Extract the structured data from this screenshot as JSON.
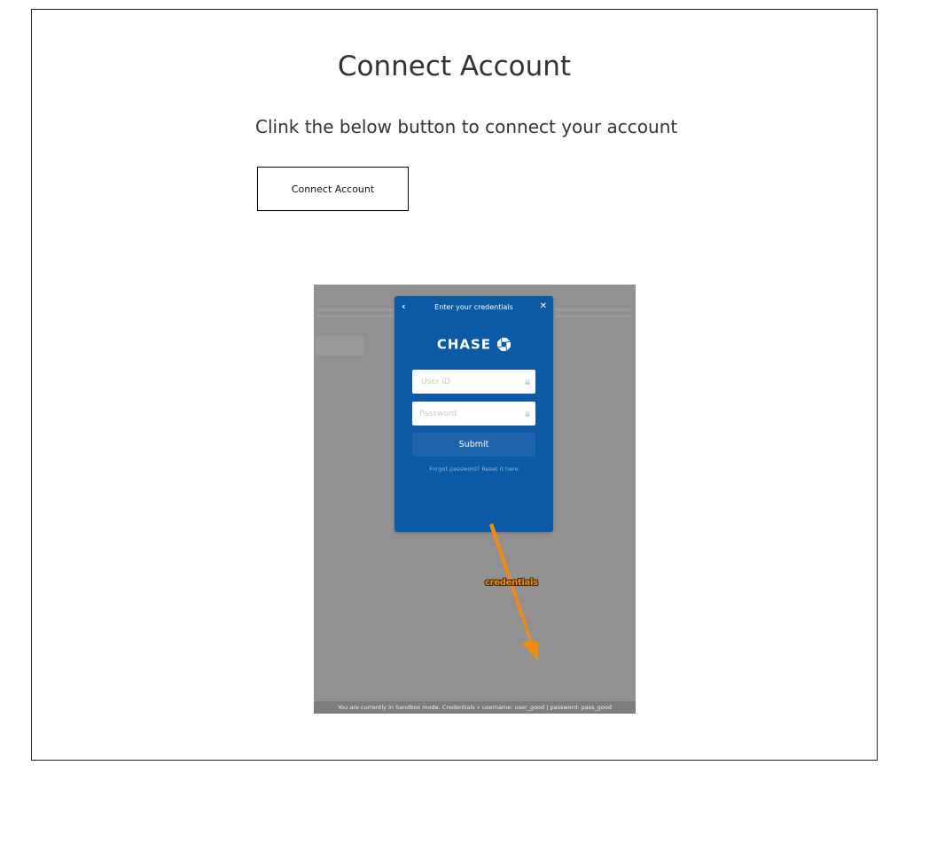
{
  "page": {
    "title": "Connect Account",
    "instruction": "Clink the below button to connect your account",
    "connect_button_label": "Connect Account"
  },
  "screenshot": {
    "modal": {
      "back_icon": "chevron-left-icon",
      "title": "Enter your credentials",
      "close_icon": "close-icon",
      "logo_text": "CHASE",
      "userid_placeholder": "User ID",
      "password_placeholder": "Password",
      "submit_label": "Submit",
      "forgot_text": "Forgot password? Reset it here"
    },
    "annotation_label": "credentials",
    "sandbox_notice": "You are currently in Sandbox mode. Credentials » username: user_good | password: pass_good"
  },
  "colors": {
    "modal_bg": "#0c5aa6",
    "overlay_bg": "#919191",
    "annotation": "#f28c0f"
  }
}
